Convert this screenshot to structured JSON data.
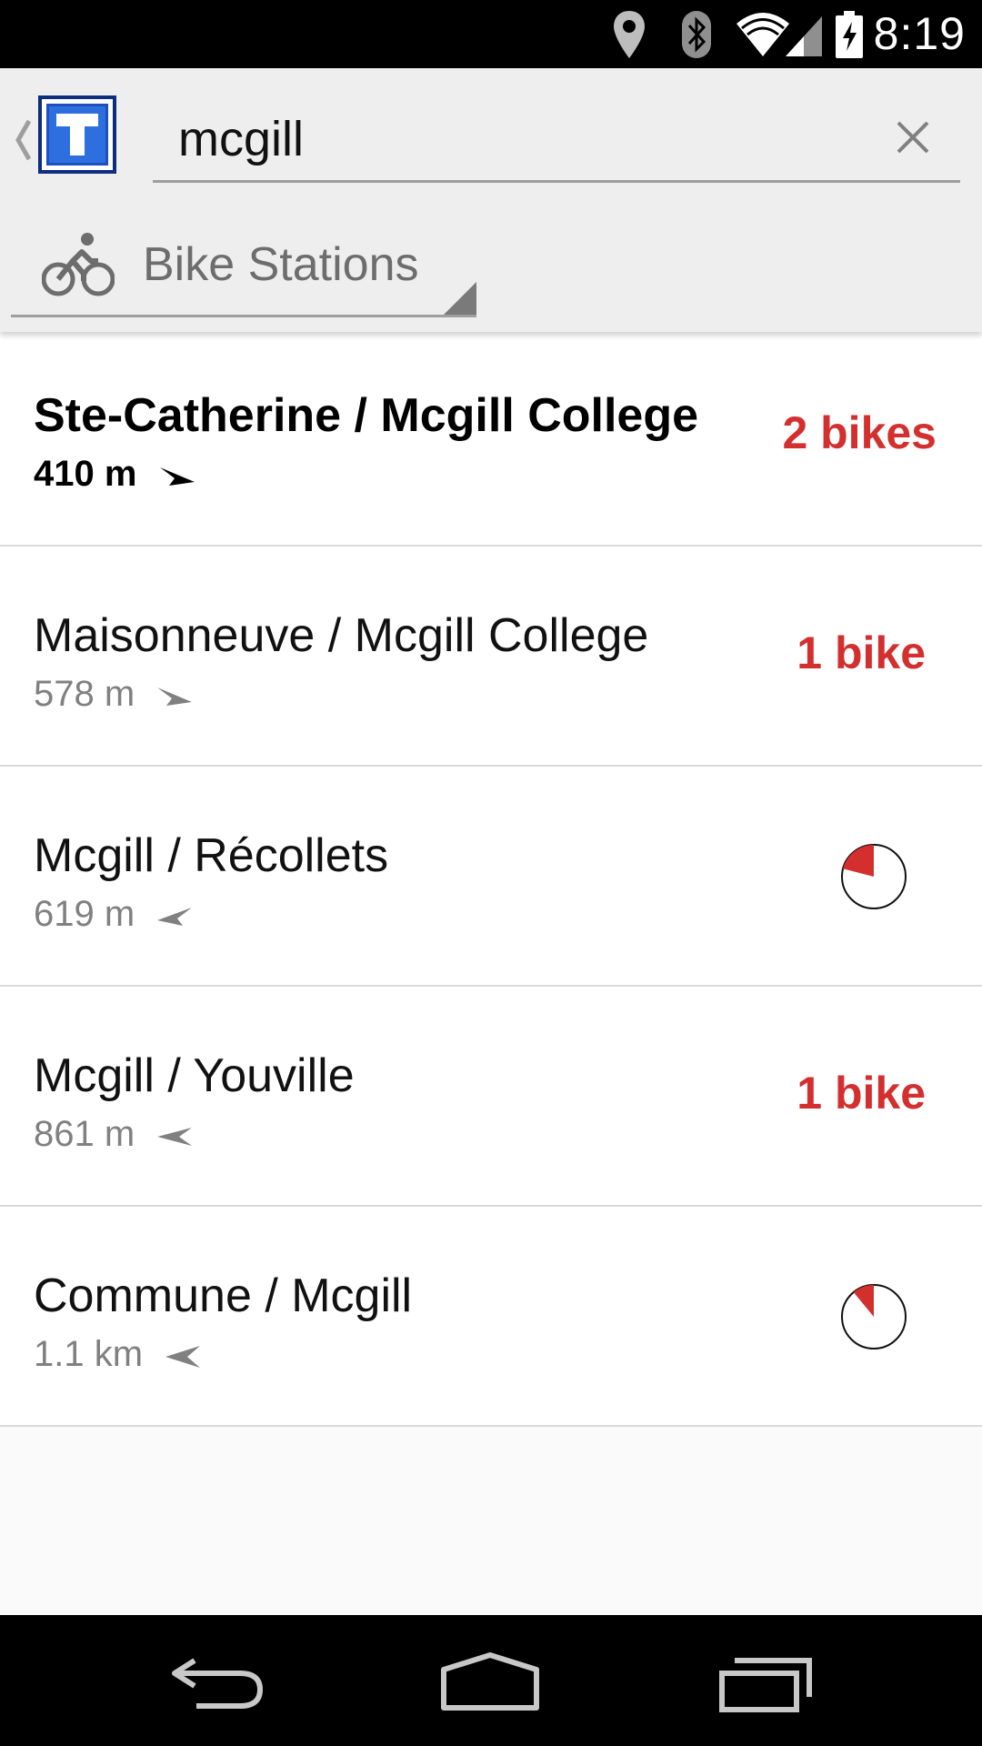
{
  "status_bar": {
    "time": "8:19",
    "icons": [
      "location-icon",
      "bluetooth-icon",
      "wifi-icon",
      "signal-icon",
      "battery-icon"
    ]
  },
  "action_bar": {
    "logo_letter": "T",
    "search": {
      "value": "mcgill",
      "clear_icon": "close-icon"
    },
    "category": {
      "label": "Bike Stations",
      "icon": "bike-icon"
    }
  },
  "stations": [
    {
      "name": "Ste-Catherine / Mcgill College",
      "distance": "410 m",
      "availability": "2 bikes",
      "bold": true,
      "direction": "east"
    },
    {
      "name": "Maisonneuve / Mcgill College",
      "distance": "578 m",
      "availability": "1 bike",
      "bold": false,
      "direction": "east"
    },
    {
      "name": "Mcgill / Récollets",
      "distance": "619 m",
      "availability_pie_fraction": 0.21,
      "bold": false,
      "direction": "west"
    },
    {
      "name": "Mcgill / Youville",
      "distance": "861 m",
      "availability": "1 bike",
      "bold": false,
      "direction": "west"
    },
    {
      "name": "Commune / Mcgill",
      "distance": "1.1 km",
      "availability_pie_fraction": 0.11,
      "bold": false,
      "direction": "west"
    }
  ],
  "colors": {
    "availability": "#d32f2f",
    "logo_blue": "#1e4fbf"
  },
  "nav_bar": {
    "buttons": [
      "back-icon",
      "home-icon",
      "recents-icon"
    ]
  }
}
